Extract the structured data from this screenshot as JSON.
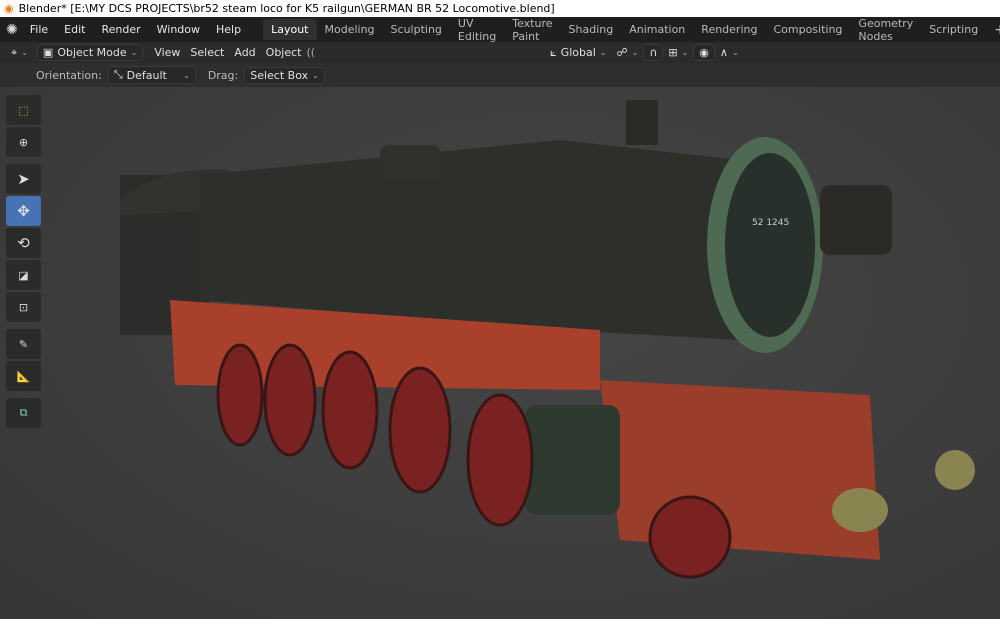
{
  "window": {
    "title": "Blender* [E:\\MY DCS PROJECTS\\br52 steam loco for K5 railgun\\GERMAN BR 52 Locomotive.blend]"
  },
  "menus": [
    "File",
    "Edit",
    "Render",
    "Window",
    "Help"
  ],
  "workspaces": [
    {
      "label": "Layout",
      "active": true
    },
    {
      "label": "Modeling"
    },
    {
      "label": "Sculpting"
    },
    {
      "label": "UV Editing"
    },
    {
      "label": "Texture Paint"
    },
    {
      "label": "Shading"
    },
    {
      "label": "Animation"
    },
    {
      "label": "Rendering"
    },
    {
      "label": "Compositing"
    },
    {
      "label": "Geometry Nodes"
    },
    {
      "label": "Scripting"
    }
  ],
  "add_workspace": "+",
  "header": {
    "mode": "Object Mode",
    "view": "View",
    "select": "Select",
    "add": "Add",
    "object": "Object",
    "transform_orientation": "Global"
  },
  "tool_settings": {
    "orientation_label": "Orientation:",
    "orientation_value": "Default",
    "drag_label": "Drag:",
    "drag_value": "Select Box"
  },
  "toolbar": [
    "select-box",
    "cursor",
    "tweak",
    "move",
    "rotate",
    "scale",
    "transform",
    "annotate",
    "measure",
    "add-cube"
  ],
  "active_tool": "move",
  "scene": {
    "loco_number": "52 1245"
  },
  "colors": {
    "accent": "#4772b3",
    "body": "#2c2f2a",
    "frame": "#a8402c"
  }
}
